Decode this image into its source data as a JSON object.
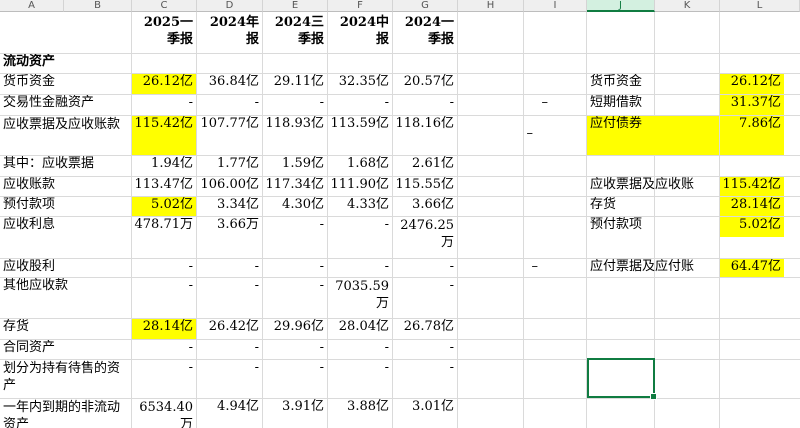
{
  "columns": [
    "A",
    "B",
    "C",
    "D",
    "E",
    "F",
    "G",
    "H",
    "I",
    "J",
    "K",
    "L"
  ],
  "selected_column": "J",
  "headers": {
    "c": [
      "2025一",
      "季报"
    ],
    "d": [
      "2024年",
      "报"
    ],
    "e": [
      "2024三",
      "季报"
    ],
    "f": [
      "2024中",
      "报"
    ],
    "g": [
      "2024一",
      "季报"
    ]
  },
  "section_title": "流动资产",
  "rows": {
    "cash": {
      "label": "货币资金",
      "c": "26.12亿",
      "d": "36.84亿",
      "e": "29.11亿",
      "f": "32.35亿",
      "g": "20.57亿"
    },
    "trading": {
      "label": "交易性金融资产",
      "c": "-",
      "d": "-",
      "e": "-",
      "f": "-",
      "g": "-"
    },
    "notes_ar": {
      "label": "应收票据及应收账款",
      "c": "115.42亿",
      "d": "107.77亿",
      "e": "118.93亿",
      "f": "113.59亿",
      "g": "118.16亿"
    },
    "notes": {
      "label": "其中：应收票据",
      "c": "1.94亿",
      "d": "1.77亿",
      "e": "1.59亿",
      "f": "1.68亿",
      "g": "2.61亿"
    },
    "ar": {
      "label": "应收账款",
      "c": "113.47亿",
      "d": "106.00亿",
      "e": "117.34亿",
      "f": "111.90亿",
      "g": "115.55亿"
    },
    "prepay": {
      "label": "预付款项",
      "c": "5.02亿",
      "d": "3.34亿",
      "e": "4.30亿",
      "f": "4.33亿",
      "g": "3.66亿"
    },
    "interest": {
      "label": "应收利息",
      "c": "478.71万",
      "d": "3.66万",
      "e": "-",
      "f": "-",
      "g": "2476.25万"
    },
    "dividend": {
      "label": "应收股利",
      "c": "-",
      "d": "-",
      "e": "-",
      "f": "-",
      "g": "-"
    },
    "other_ar": {
      "label": "其他应收款",
      "c": "-",
      "d": "-",
      "e": "-",
      "f": "7035.59万",
      "g": "-"
    },
    "inventory": {
      "label": "存货",
      "c": "28.14亿",
      "d": "26.42亿",
      "e": "29.96亿",
      "f": "28.04亿",
      "g": "26.78亿"
    },
    "contract": {
      "label": "合同资产",
      "c": "-",
      "d": "-",
      "e": "-",
      "f": "-",
      "g": "-"
    },
    "held_sale": {
      "label": "划分为持有待售的资产",
      "c": "-",
      "d": "-",
      "e": "-",
      "f": "-",
      "g": "-"
    },
    "noncurrent": {
      "label": "一年内到期的非流动资产",
      "c": "6534.40万",
      "d": "4.94亿",
      "e": "3.91亿",
      "f": "3.88亿",
      "g": "3.01亿"
    }
  },
  "right_panel": {
    "cash": {
      "label": "货币资金",
      "value": "26.12亿"
    },
    "short_loan": {
      "marker": "–",
      "label": "短期借款",
      "value": "31.37亿"
    },
    "bonds": {
      "marker": "–",
      "label": "应付债券",
      "value": "7.86亿"
    },
    "notes_ar": {
      "label": "应收票据及应收账",
      "value": "115.42亿"
    },
    "inventory": {
      "label": "存货",
      "value": "28.14亿"
    },
    "prepay": {
      "label": "预付款项",
      "value": "5.02亿"
    },
    "payables": {
      "marker": "–",
      "label": "应付票据及应付账",
      "value": "64.47亿"
    }
  },
  "colors": {
    "highlight": "#ffff00",
    "selection": "#107c41"
  }
}
